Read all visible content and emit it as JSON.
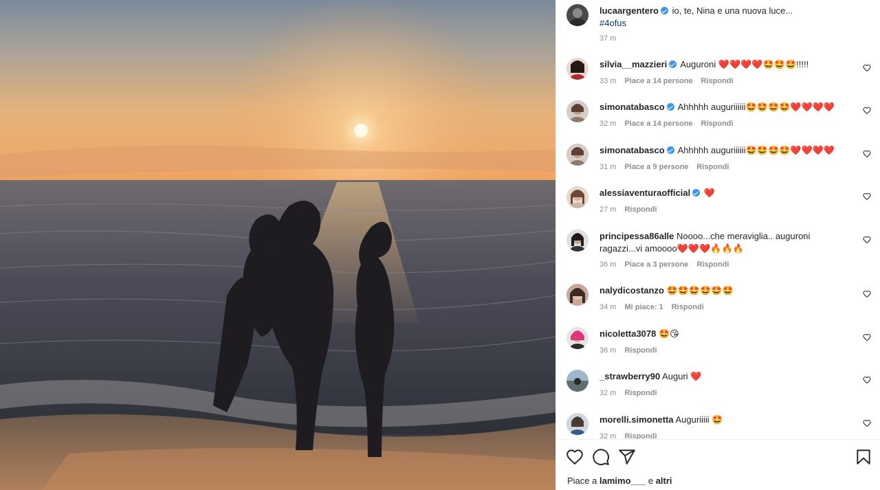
{
  "post": {
    "author": "lucaargentero",
    "caption": "io, te, Nina e una nuova luce...",
    "hashtag": "#4ofus",
    "time": "37 m"
  },
  "labels": {
    "like_count_prefix": "Piace a",
    "reply": "Rispondi"
  },
  "comments": [
    {
      "user": "silvia__mazzieri",
      "verified": true,
      "text": "Auguroni ❤️❤️❤️❤️🤩🤩🤩!!!!!",
      "time": "33 m",
      "likes": "Piace a 14 persone",
      "reply": "Rispondi"
    },
    {
      "user": "simonatabasco",
      "verified": true,
      "text": "Ahhhhh auguriiiiii🤩🤩🤩🤩❤️❤️❤️❤️",
      "time": "32 m",
      "likes": "Piace a 14 persone",
      "reply": "Rispondi"
    },
    {
      "user": "simonatabasco",
      "verified": true,
      "text": "Ahhhhh auguriiiiii🤩🤩🤩🤩❤️❤️❤️❤️",
      "time": "31 m",
      "likes": "Piace a 9 persone",
      "reply": "Rispondi"
    },
    {
      "user": "alessiaventuraofficial",
      "verified": true,
      "text": "❤️",
      "time": "27 m",
      "likes": "",
      "reply": "Rispondi"
    },
    {
      "user": "principessa86alle",
      "verified": false,
      "text": "Noooo...che meraviglia.. auguroni ragazzi...vi amoooo❤️❤️❤️🔥🔥🔥",
      "time": "36 m",
      "likes": "Piace a 3 persone",
      "reply": "Rispondi"
    },
    {
      "user": "nalydicostanzo",
      "verified": false,
      "text": "🤩🤩🤩🤩🤩🤩",
      "time": "34 m",
      "likes": "Mi piace: 1",
      "reply": "Rispondi"
    },
    {
      "user": "nicoletta3078",
      "verified": false,
      "text": "🤩😘",
      "time": "36 m",
      "likes": "",
      "reply": "Rispondi"
    },
    {
      "user": "_strawberry90",
      "verified": false,
      "text": "Auguri ❤️",
      "time": "32 m",
      "likes": "",
      "reply": "Rispondi"
    },
    {
      "user": "morelli.simonetta",
      "verified": false,
      "text": "Auguriiiii 🤩",
      "time": "32 m",
      "likes": "",
      "reply": "Rispondi"
    }
  ],
  "footer": {
    "liked_prefix": "Piace a",
    "liked_user": "lamimo___",
    "liked_conj": "e",
    "liked_others": "altri"
  },
  "icons": {
    "like": "heart-icon",
    "comment": "comment-icon",
    "share": "paper-plane-icon",
    "save": "bookmark-icon"
  },
  "colors": {
    "text": "#262626",
    "secondary": "#8e8e8e",
    "verified": "#3897f0",
    "hashtag": "#00376b"
  }
}
